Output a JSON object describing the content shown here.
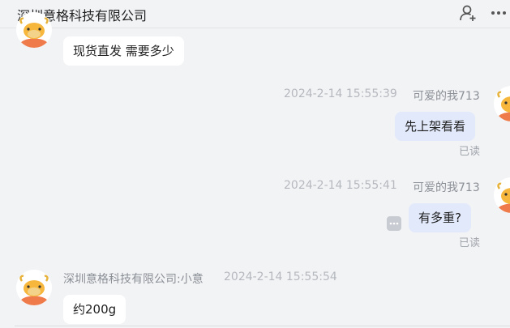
{
  "header": {
    "title": "深圳意格科技有限公司",
    "icons": [
      "add-contact-icon",
      "more-icon"
    ]
  },
  "messages": [
    {
      "side": "in",
      "text": "现货直发 需要多少",
      "avatar": "bull-avatar"
    },
    {
      "side": "out",
      "time": "2024-2-14 15:55:39",
      "sender": "可爱的我713",
      "text": "先上架看看",
      "status": "已读",
      "avatar": "bull-avatar"
    },
    {
      "side": "out",
      "time": "2024-2-14 15:55:41",
      "sender": "可爱的我713",
      "text": "有多重?",
      "status": "已读",
      "avatar": "bull-avatar",
      "extra_icon": "ellipsis-chip-icon"
    },
    {
      "side": "in",
      "sender": "深圳意格科技有限公司:小意",
      "time": "2024-2-14 15:55:54",
      "text": "约200g",
      "avatar": "bull-avatar"
    }
  ],
  "colors": {
    "background": "#f2f3f5",
    "incoming_bubble": "#ffffff",
    "outgoing_bubble": "#e2e9fb",
    "avatar_orange": "#ef7b4b",
    "avatar_face": "#f7b73c"
  }
}
